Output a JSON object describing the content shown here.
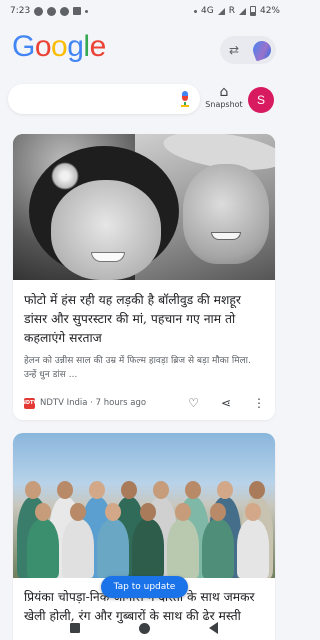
{
  "status_bar": {
    "time": "7:23",
    "network": "4G",
    "roaming": "R",
    "battery": "42%"
  },
  "header": {
    "logo_letters": [
      {
        "char": "G",
        "color": "#4285f4"
      },
      {
        "char": "o",
        "color": "#ea4335"
      },
      {
        "char": "o",
        "color": "#fbbc04"
      },
      {
        "char": "g",
        "color": "#4285f4"
      },
      {
        "char": "l",
        "color": "#34a853"
      },
      {
        "char": "e",
        "color": "#ea4335"
      }
    ],
    "switch_glyph": "⇄",
    "snapshot_glyph": "⌂",
    "snapshot_label": "Snapshot",
    "avatar_letter": "S"
  },
  "search": {
    "placeholder": ""
  },
  "cards": [
    {
      "headline": "फोटो में हंस रही यह लड़की है बॉलीवुड की मशहूर डांसर और सुपरस्टार की मां, पहचान गए नाम तो कहलाएंगे सरताज",
      "snippet": "हेलन को उन्नीस साल की उम्र में फिल्म हावड़ा ब्रिज से बड़ा मौका मिला. उन्हें धुन डांस ...",
      "source_logo": "NDTV",
      "source": "NDTV India",
      "time": "7 hours ago",
      "like_glyph": "♡",
      "share_glyph": "⋖",
      "more_glyph": "⋮"
    },
    {
      "headline": "प्रियंका चोपड़ा-निक जोनास ने दोस्तों के साथ जमकर खेली होली, रंग और गुब्बारों के साथ की ढेर मस्ती"
    }
  ],
  "tap_to_update": "Tap to update"
}
